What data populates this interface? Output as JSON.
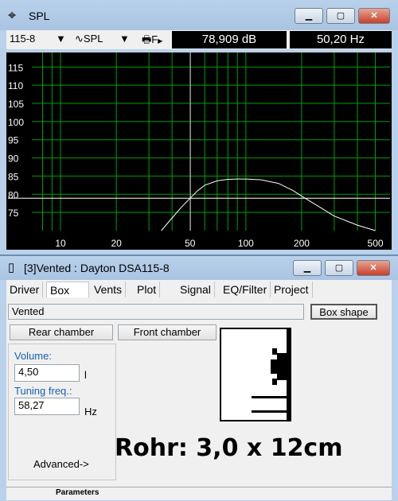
{
  "spl_window": {
    "title": "SPL",
    "toolbar": {
      "driver_select": "115-8",
      "mode_select": "SPL",
      "print_label": "F",
      "readout_db": "78,909 dB",
      "readout_hz": "50,20 Hz"
    },
    "chart_data": {
      "type": "line",
      "x_scale": "log",
      "xlim": [
        7,
        600
      ],
      "ylim": [
        70,
        119
      ],
      "x_ticks": [
        "10",
        "20",
        "50",
        "100",
        "200",
        "500"
      ],
      "y_ticks": [
        "115",
        "110",
        "105",
        "100",
        "95",
        "90",
        "85",
        "80",
        "75"
      ],
      "cursor_x": 50.2,
      "cursor_y": 78.909,
      "grid": true,
      "series": [
        {
          "color": "#ffffff",
          "x": [
            35,
            40,
            45,
            50,
            55,
            60,
            70,
            80,
            90,
            100,
            120,
            150,
            180,
            200,
            250,
            300,
            400,
            500
          ],
          "y": [
            70,
            73.5,
            76.5,
            78.9,
            81,
            82.5,
            83.7,
            84.1,
            84.2,
            84.2,
            84,
            83,
            81,
            79.5,
            76.5,
            74,
            71.5,
            70
          ]
        }
      ]
    }
  },
  "vented_window": {
    "title": "[3]Vented : Dayton DSA115-8",
    "tabs": [
      "Driver",
      "Box",
      "Vents",
      "Plot",
      "Signal",
      "EQ/Filter",
      "Project"
    ],
    "active_tab": "Box",
    "box_type": "Vented",
    "box_shape_button": "Box shape",
    "rear_chamber_button": "Rear chamber",
    "front_chamber_button": "Front chamber",
    "volume_label": "Volume:",
    "volume_value": "4,50",
    "volume_unit": "l",
    "tuning_label": "Tuning freq.:",
    "tuning_value": "58,27",
    "tuning_unit": "Hz",
    "advanced_link": "Advanced->",
    "annotation": "Rohr: 3,0 x 12cm",
    "status_bar": "Parameters"
  }
}
